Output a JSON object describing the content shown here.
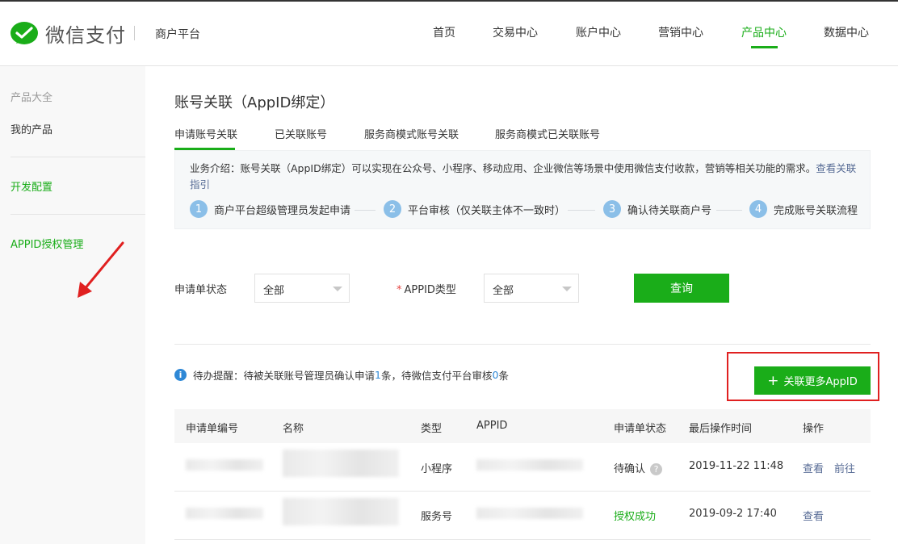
{
  "brand": {
    "name": "微信支付",
    "platform": "商户平台"
  },
  "nav": [
    {
      "label": "首页",
      "active": false
    },
    {
      "label": "交易中心",
      "active": false
    },
    {
      "label": "账户中心",
      "active": false
    },
    {
      "label": "营销中心",
      "active": false
    },
    {
      "label": "产品中心",
      "active": true
    },
    {
      "label": "数据中心",
      "active": false
    }
  ],
  "sidebar": {
    "section_title": "产品大全",
    "my_products": "我的产品",
    "dev_config": "开发配置",
    "appid_auth": "APPID授权管理"
  },
  "page": {
    "title": "账号关联（AppID绑定）",
    "tabs": [
      "申请账号关联",
      "已关联账号",
      "服务商模式账号关联",
      "服务商模式已关联账号"
    ],
    "intro_text": "业务介绍：账号关联（AppID绑定）可以实现在公众号、小程序、移动应用、企业微信等场景中使用微信支付收款，营销等相关功能的需求。",
    "intro_link": "查看关联指引",
    "steps": [
      {
        "num": "1",
        "label": "商户平台超级管理员发起申请"
      },
      {
        "num": "2",
        "label": "平台审核（仅关联主体不一致时）"
      },
      {
        "num": "3",
        "label": "确认待关联商户号"
      },
      {
        "num": "4",
        "label": "完成账号关联流程"
      }
    ]
  },
  "filters": {
    "status_label": "申请单状态",
    "status_value": "全部",
    "required_mark": "*",
    "type_label": "APPID类型",
    "type_value": "全部",
    "query_button": "查询"
  },
  "todo": {
    "info_icon": "i",
    "prefix": "待办提醒：待被关联账号管理员确认申请",
    "count1": "1",
    "middle": "条，待微信支付平台审核",
    "count2": "0",
    "suffix": "条"
  },
  "add_button": {
    "plus": "+",
    "label": "关联更多AppID"
  },
  "table": {
    "headers": [
      "申请单编号",
      "名称",
      "类型",
      "APPID",
      "申请单状态",
      "最后操作时间",
      "操作"
    ],
    "rows": [
      {
        "type": "小程序",
        "status": "待确认",
        "status_help": "?",
        "time": "2019-11-22 11:48",
        "action1": "查看",
        "action2": "前往"
      },
      {
        "type": "服务号",
        "status": "授权成功",
        "time": "2019-09-2 17:40",
        "action1": "查看"
      }
    ]
  },
  "colors": {
    "accent": "#1aad19",
    "link": "#576b95",
    "highlight_box": "#e02020"
  }
}
